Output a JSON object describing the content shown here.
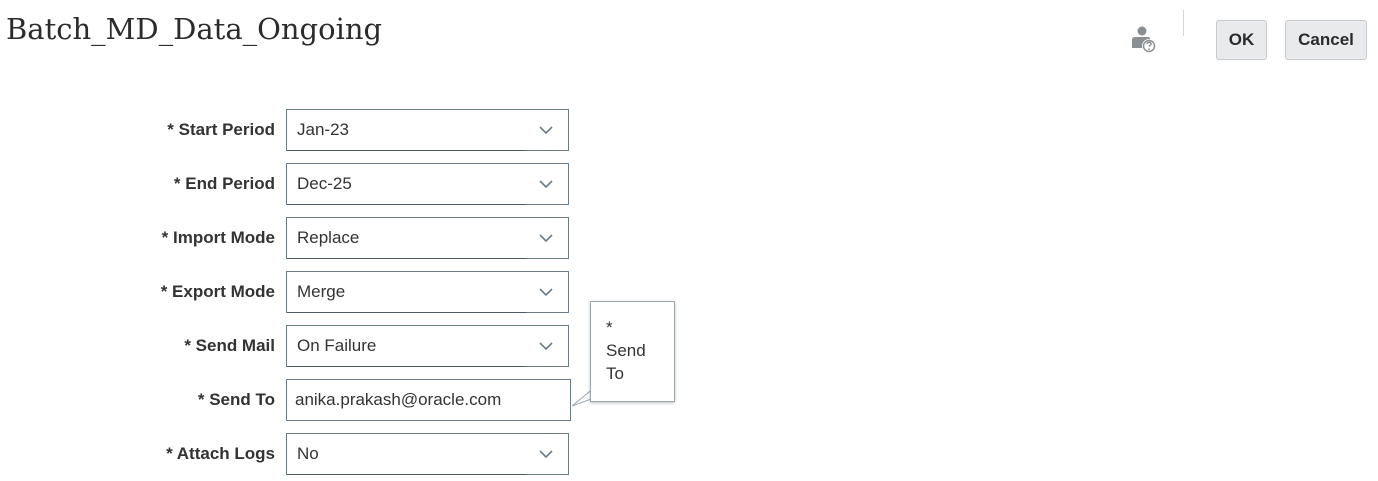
{
  "header": {
    "title": "Batch_MD_Data_Ongoing",
    "help_icon": "user-help-icon",
    "ok_label": "OK",
    "cancel_label": "Cancel"
  },
  "form": {
    "fields": [
      {
        "label": "* Start Period",
        "type": "select",
        "value": "Jan-23"
      },
      {
        "label": "* End Period",
        "type": "select",
        "value": "Dec-25"
      },
      {
        "label": "* Import Mode",
        "type": "select",
        "value": "Replace"
      },
      {
        "label": "* Export Mode",
        "type": "select",
        "value": "Merge"
      },
      {
        "label": "* Send Mail",
        "type": "select",
        "value": "On Failure"
      },
      {
        "label": "* Send To",
        "type": "text",
        "value": "anika.prakash@oracle.com"
      },
      {
        "label": "* Attach Logs",
        "type": "select",
        "value": "No"
      }
    ],
    "caret_icon": "chevron-down-icon"
  },
  "tooltip": {
    "line1": "*",
    "line2": "Send",
    "line3": "To"
  },
  "colors": {
    "button_bg": "#e8eaeb",
    "field_border": "#6b7b86",
    "text": "#333333"
  }
}
